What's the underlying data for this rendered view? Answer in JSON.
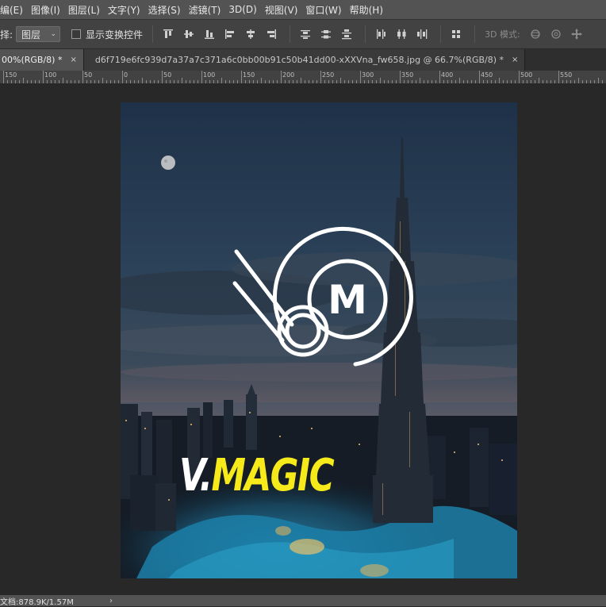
{
  "menubar": {
    "items": [
      "编(E)",
      "图像(I)",
      "图层(L)",
      "文字(Y)",
      "选择(S)",
      "滤镜(T)",
      "3D(D)",
      "视图(V)",
      "窗口(W)",
      "帮助(H)"
    ]
  },
  "optionsbar": {
    "select_label": "择:",
    "select_value": "图层",
    "checkbox_label": "显示变换控件",
    "mode_label": "3D 模式:"
  },
  "tabs": [
    {
      "label": "00%(RGB/8) *",
      "close": "×"
    },
    {
      "label": "d6f719e6fc939d7a37a7c371a6c0bb00b91c50b41dd00-xXXVna_fw658.jpg @ 66.7%(RGB/8) *",
      "close": "×"
    }
  ],
  "ruler": {
    "labels": [
      "150",
      "100",
      "50",
      "0",
      "50",
      "100",
      "150",
      "200",
      "250",
      "300",
      "350",
      "400",
      "450",
      "500",
      "550"
    ]
  },
  "document": {
    "brand_v": "V.",
    "brand_magic": "MAGIC",
    "logo_letter": "M"
  },
  "statusbar": {
    "doc_size": "文档:878.9K/1.57M",
    "arrow": "›"
  },
  "colors": {
    "menubar_bg": "#535353",
    "options_bg": "#424242",
    "workspace_bg": "#282828",
    "brand_yellow": "#f7ea1a"
  }
}
